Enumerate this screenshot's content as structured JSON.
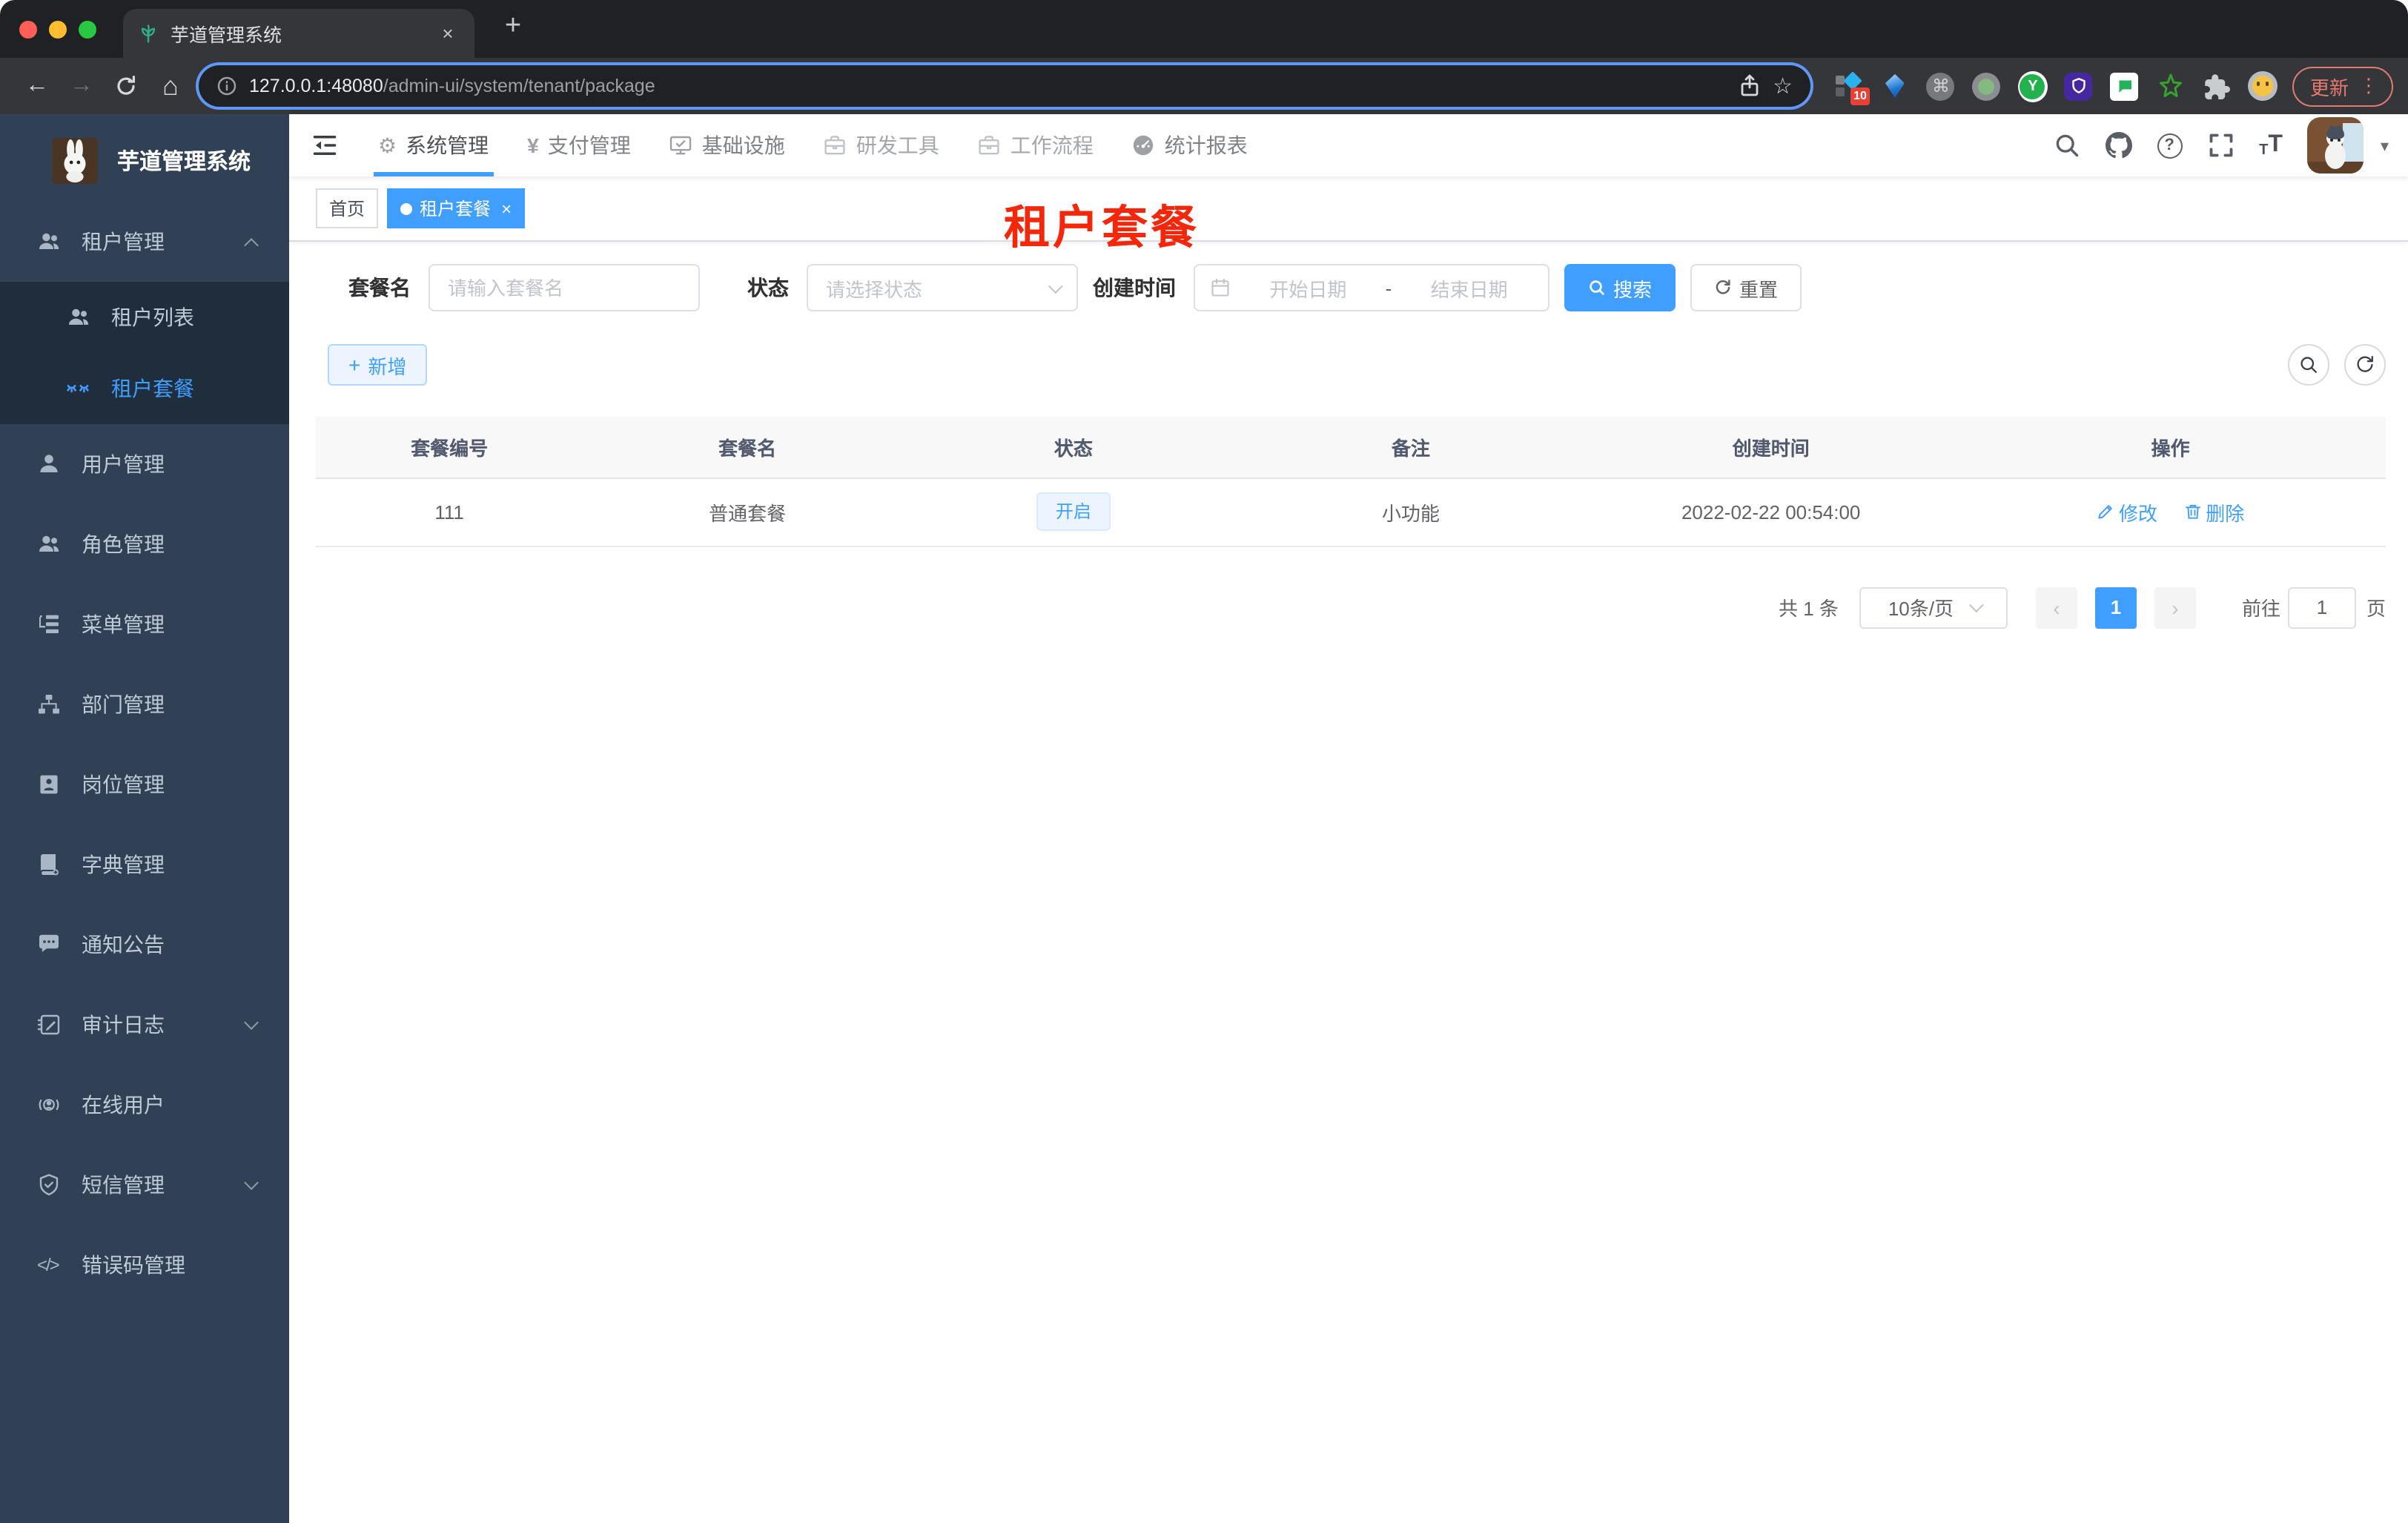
{
  "browser": {
    "tab_title": "芋道管理系统",
    "url_host": "127.0.0.1:48080",
    "url_path": "/admin-ui/system/tenant/package",
    "update_label": "更新",
    "extension_badge": "10"
  },
  "icons": {
    "back_arrow": "←",
    "forward_arrow": "→",
    "home": "⌂",
    "star": "☆",
    "tab_close": "×",
    "new_tab": "+",
    "kebab": "⋮",
    "command": "⌘",
    "ext_y": "Y",
    "gear": "⚙",
    "yen": "¥",
    "question": "?",
    "font_size_small": "T",
    "font_size_large": "T",
    "caret_down": "▾",
    "code": "</>",
    "plus": "+",
    "prev_arrow": "‹",
    "next_arrow": "›",
    "tag_close": "×"
  },
  "colors": {
    "accent": "#409eff",
    "sidebar_bg": "#304156",
    "submenu_bg": "#1f2d3d",
    "annotation_red": "#f5270b",
    "traffic_close": "#ff5f57",
    "traffic_min": "#febc2e",
    "traffic_zoom": "#28c840",
    "status_tag_bg": "#ecf5ff"
  },
  "sidebar": {
    "logo_title": "芋道管理系统",
    "menu": [
      {
        "label": "租户管理",
        "children": [
          {
            "label": "租户列表"
          },
          {
            "label": "租户套餐"
          }
        ]
      },
      {
        "label": "用户管理"
      },
      {
        "label": "角色管理"
      },
      {
        "label": "菜单管理"
      },
      {
        "label": "部门管理"
      },
      {
        "label": "岗位管理"
      },
      {
        "label": "字典管理"
      },
      {
        "label": "通知公告"
      },
      {
        "label": "审计日志"
      },
      {
        "label": "在线用户"
      },
      {
        "label": "短信管理"
      },
      {
        "label": "错误码管理"
      }
    ]
  },
  "topnav": {
    "items": [
      {
        "label": "系统管理"
      },
      {
        "label": "支付管理"
      },
      {
        "label": "基础设施"
      },
      {
        "label": "研发工具"
      },
      {
        "label": "工作流程"
      },
      {
        "label": "统计报表"
      }
    ]
  },
  "tags": {
    "items": [
      {
        "label": "首页"
      },
      {
        "label": "租户套餐"
      }
    ]
  },
  "annotation": {
    "text": "租户套餐"
  },
  "filters": {
    "package_name_label": "套餐名",
    "package_name_placeholder": "请输入套餐名",
    "status_label": "状态",
    "status_placeholder": "请选择状态",
    "create_time_label": "创建时间",
    "start_date_placeholder": "开始日期",
    "range_separator": "-",
    "end_date_placeholder": "结束日期",
    "search_button": "搜索",
    "reset_button": "重置"
  },
  "toolbar": {
    "add_button": "新增"
  },
  "table": {
    "columns": [
      "套餐编号",
      "套餐名",
      "状态",
      "备注",
      "创建时间",
      "操作"
    ],
    "rows": [
      {
        "id": "111",
        "name": "普通套餐",
        "status": "开启",
        "remark": "小功能",
        "create_time": "2022-02-22 00:54:00",
        "actions": [
          "修改",
          "删除"
        ]
      }
    ]
  },
  "pagination": {
    "total_text": "共 1 条",
    "page_size": "10条/页",
    "current_page": "1",
    "goto_label": "前往",
    "goto_value": "1",
    "page_unit": "页"
  }
}
